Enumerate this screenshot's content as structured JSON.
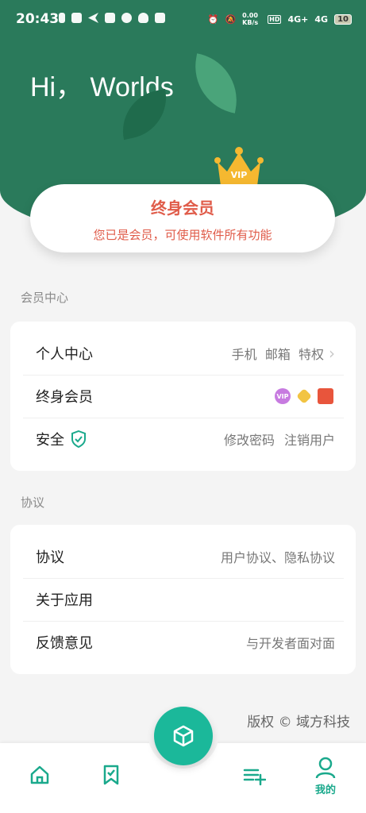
{
  "status_bar": {
    "time": "20:43",
    "net_speed": "0.00 KB/s",
    "signal1": "4G+",
    "signal2": "4G",
    "battery": "10"
  },
  "header": {
    "greeting": "Hi， Worlds",
    "crown_badge": "VIP"
  },
  "member_card": {
    "title": "终身会员",
    "subtitle": "您已是会员，可使用软件所有功能",
    "accent": "#e05c4a"
  },
  "sections": {
    "member_center": {
      "title": "会员中心",
      "rows": [
        {
          "label": "个人中心",
          "value": "手机  邮箱  特权"
        },
        {
          "label": "终身会员",
          "value": ""
        },
        {
          "label": "安全",
          "value_a": "修改密码",
          "value_b": "注销用户"
        }
      ]
    },
    "agreement": {
      "title": "协议",
      "rows": [
        {
          "label": "协议",
          "value": "用户协议、隐私协议"
        },
        {
          "label": "关于应用",
          "value": ""
        },
        {
          "label": "反馈意见",
          "value": "与开发者面对面"
        }
      ]
    }
  },
  "vip_badge_text": "VIP",
  "copyright": "版权 © 域方科技",
  "tabbar": {
    "active_label": "我的",
    "accent": "#1aa98c"
  },
  "colors": {
    "header_green": "#2a7a5b",
    "fab_teal": "#1bb89a"
  }
}
